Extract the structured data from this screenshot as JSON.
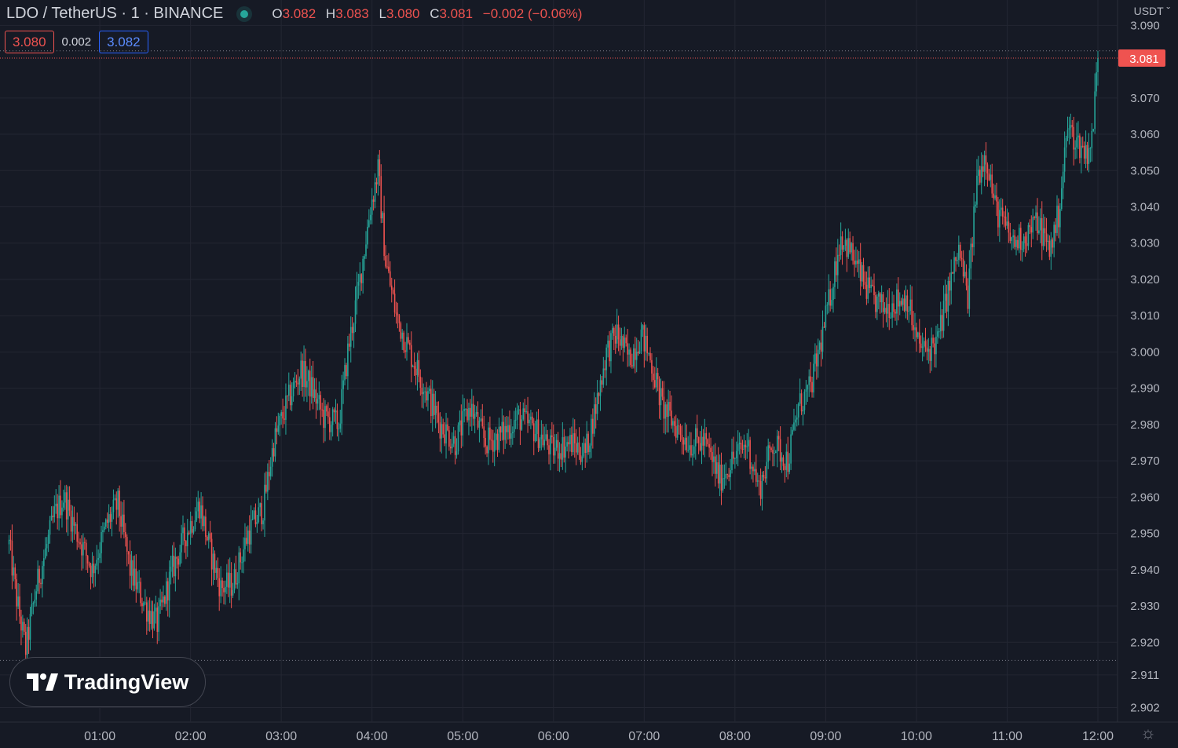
{
  "legend": {
    "symbol": "LDO / TetherUS · 1 · BINANCE",
    "o_label": "O",
    "o_value": "3.082",
    "h_label": "H",
    "h_value": "3.083",
    "l_label": "L",
    "l_value": "3.080",
    "c_label": "C",
    "c_value": "3.081",
    "change": "−0.002 (−0.06%)"
  },
  "quote": {
    "sell": "3.080",
    "spread": "0.002",
    "buy": "3.082"
  },
  "currency": "USDT",
  "logo_text": "TradingView",
  "icons": {
    "status": "market-open-dot-icon",
    "settings": "gear-icon",
    "currency_menu": "chevron-down-icon"
  },
  "colors": {
    "up": "#26a69a",
    "down": "#ef5350",
    "background": "#161a25",
    "grid": "#232632"
  },
  "chart_data": {
    "type": "candlestick",
    "title": "LDO / TetherUS · 1 · BINANCE",
    "timeframe": "1 minute",
    "last_price": 3.081,
    "last_price_label": "3.081",
    "ylim": [
      2.898,
      3.097
    ],
    "xlim_minutes": [
      -6,
      720
    ],
    "period_high": 3.083,
    "period_low": 2.915,
    "y_ticks": [
      "3.090",
      "3.070",
      "3.060",
      "3.050",
      "3.040",
      "3.030",
      "3.020",
      "3.010",
      "3.000",
      "2.990",
      "2.980",
      "2.970",
      "2.960",
      "2.950",
      "2.940",
      "2.930",
      "2.920",
      "2.911",
      "2.902"
    ],
    "x_ticks": [
      {
        "label": "01:00",
        "minute": 60
      },
      {
        "label": "02:00",
        "minute": 120
      },
      {
        "label": "03:00",
        "minute": 180
      },
      {
        "label": "04:00",
        "minute": 240
      },
      {
        "label": "05:00",
        "minute": 300
      },
      {
        "label": "06:00",
        "minute": 360
      },
      {
        "label": "07:00",
        "minute": 420
      },
      {
        "label": "08:00",
        "minute": 480
      },
      {
        "label": "09:00",
        "minute": 540
      },
      {
        "label": "10:00",
        "minute": 600
      },
      {
        "label": "11:00",
        "minute": 660
      },
      {
        "label": "12:00",
        "minute": 720
      }
    ],
    "price_path": [
      {
        "t": 0,
        "p": 2.947
      },
      {
        "t": 5,
        "p": 2.932
      },
      {
        "t": 11,
        "p": 2.918
      },
      {
        "t": 18,
        "p": 2.935
      },
      {
        "t": 30,
        "p": 2.955
      },
      {
        "t": 36,
        "p": 2.96
      },
      {
        "t": 45,
        "p": 2.95
      },
      {
        "t": 55,
        "p": 2.94
      },
      {
        "t": 65,
        "p": 2.953
      },
      {
        "t": 72,
        "p": 2.958
      },
      {
        "t": 80,
        "p": 2.94
      },
      {
        "t": 90,
        "p": 2.93
      },
      {
        "t": 98,
        "p": 2.925
      },
      {
        "t": 108,
        "p": 2.94
      },
      {
        "t": 117,
        "p": 2.95
      },
      {
        "t": 126,
        "p": 2.958
      },
      {
        "t": 133,
        "p": 2.945
      },
      {
        "t": 140,
        "p": 2.935
      },
      {
        "t": 148,
        "p": 2.936
      },
      {
        "t": 158,
        "p": 2.95
      },
      {
        "t": 168,
        "p": 2.957
      },
      {
        "t": 175,
        "p": 2.975
      },
      {
        "t": 184,
        "p": 2.986
      },
      {
        "t": 193,
        "p": 2.995
      },
      {
        "t": 200,
        "p": 2.99
      },
      {
        "t": 208,
        "p": 2.982
      },
      {
        "t": 218,
        "p": 2.98
      },
      {
        "t": 224,
        "p": 3.0
      },
      {
        "t": 232,
        "p": 3.02
      },
      {
        "t": 239,
        "p": 3.04
      },
      {
        "t": 244,
        "p": 3.05
      },
      {
        "t": 249,
        "p": 3.025
      },
      {
        "t": 256,
        "p": 3.01
      },
      {
        "t": 265,
        "p": 3.0
      },
      {
        "t": 275,
        "p": 2.99
      },
      {
        "t": 285,
        "p": 2.98
      },
      {
        "t": 295,
        "p": 2.975
      },
      {
        "t": 305,
        "p": 2.985
      },
      {
        "t": 315,
        "p": 2.975
      },
      {
        "t": 325,
        "p": 2.977
      },
      {
        "t": 337,
        "p": 2.982
      },
      {
        "t": 349,
        "p": 2.978
      },
      {
        "t": 359,
        "p": 2.973
      },
      {
        "t": 372,
        "p": 2.975
      },
      {
        "t": 381,
        "p": 2.972
      },
      {
        "t": 388,
        "p": 2.985
      },
      {
        "t": 395,
        "p": 3.0
      },
      {
        "t": 402,
        "p": 3.005
      },
      {
        "t": 410,
        "p": 2.998
      },
      {
        "t": 418,
        "p": 3.005
      },
      {
        "t": 424,
        "p": 2.998
      },
      {
        "t": 432,
        "p": 2.985
      },
      {
        "t": 440,
        "p": 2.98
      },
      {
        "t": 450,
        "p": 2.975
      },
      {
        "t": 460,
        "p": 2.975
      },
      {
        "t": 470,
        "p": 2.965
      },
      {
        "t": 478,
        "p": 2.97
      },
      {
        "t": 488,
        "p": 2.975
      },
      {
        "t": 496,
        "p": 2.962
      },
      {
        "t": 505,
        "p": 2.975
      },
      {
        "t": 515,
        "p": 2.97
      },
      {
        "t": 522,
        "p": 2.985
      },
      {
        "t": 530,
        "p": 2.99
      },
      {
        "t": 538,
        "p": 3.005
      },
      {
        "t": 545,
        "p": 3.02
      },
      {
        "t": 550,
        "p": 3.032
      },
      {
        "t": 556,
        "p": 3.028
      },
      {
        "t": 562,
        "p": 3.022
      },
      {
        "t": 570,
        "p": 3.015
      },
      {
        "t": 578,
        "p": 3.012
      },
      {
        "t": 586,
        "p": 3.014
      },
      {
        "t": 594,
        "p": 3.015
      },
      {
        "t": 600,
        "p": 3.003
      },
      {
        "t": 606,
        "p": 3.0
      },
      {
        "t": 614,
        "p": 3.003
      },
      {
        "t": 620,
        "p": 3.015
      },
      {
        "t": 628,
        "p": 3.028
      },
      {
        "t": 634,
        "p": 3.015
      },
      {
        "t": 640,
        "p": 3.048
      },
      {
        "t": 646,
        "p": 3.055
      },
      {
        "t": 652,
        "p": 3.04
      },
      {
        "t": 658,
        "p": 3.035
      },
      {
        "t": 664,
        "p": 3.03
      },
      {
        "t": 672,
        "p": 3.032
      },
      {
        "t": 680,
        "p": 3.036
      },
      {
        "t": 688,
        "p": 3.028
      },
      {
        "t": 694,
        "p": 3.038
      },
      {
        "t": 700,
        "p": 3.062
      },
      {
        "t": 706,
        "p": 3.058
      },
      {
        "t": 712,
        "p": 3.055
      },
      {
        "t": 716,
        "p": 3.058
      },
      {
        "t": 718,
        "p": 3.07
      },
      {
        "t": 720,
        "p": 3.081
      }
    ],
    "up_color": "#26a69a",
    "down_color": "#ef5350",
    "grid": true
  }
}
